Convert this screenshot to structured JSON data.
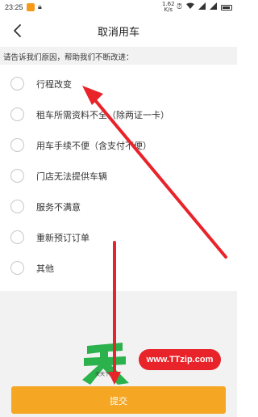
{
  "status_bar": {
    "time": "23:25",
    "net_speed_value": "1.62",
    "net_speed_unit": "K/s",
    "icons": [
      "app-icon",
      "lock-icon",
      "alarm-icon",
      "wifi-icon",
      "signal-icon",
      "signal-icon",
      "battery-icon"
    ]
  },
  "header": {
    "title": "取消用车",
    "back_icon": "chevron-left-icon"
  },
  "prompt": "请告诉我们原因，帮助我们不断改进：",
  "reasons": [
    {
      "label": "行程改变",
      "selected": false
    },
    {
      "label": "租车所需资料不全（除两证一卡）",
      "selected": false
    },
    {
      "label": "用车手续不便（含支付不便）",
      "selected": false
    },
    {
      "label": "门店无法提供车辆",
      "selected": false
    },
    {
      "label": "服务不满意",
      "selected": false
    },
    {
      "label": "重新预订订单",
      "selected": false
    },
    {
      "label": "其他",
      "selected": false
    }
  ],
  "submit": {
    "label": "提交"
  },
  "watermark": {
    "site": "www.TTzip.com",
    "caption": "天天下载"
  },
  "colors": {
    "accent": "#f5a623",
    "annotation_red": "#e8232a",
    "background_gray": "#f2f2f2"
  }
}
